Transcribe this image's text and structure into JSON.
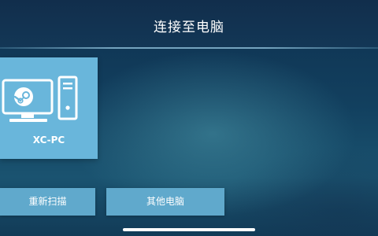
{
  "header": {
    "title": "连接至电脑"
  },
  "computers": [
    {
      "name": "XC-PC",
      "icon": "steam-pc-icon"
    }
  ],
  "buttons": {
    "rescan_label": "重新扫描",
    "other_label": "其他电脑"
  },
  "colors": {
    "tile": "#69b6db",
    "button": "#60a9cc",
    "background": "#12405f"
  }
}
